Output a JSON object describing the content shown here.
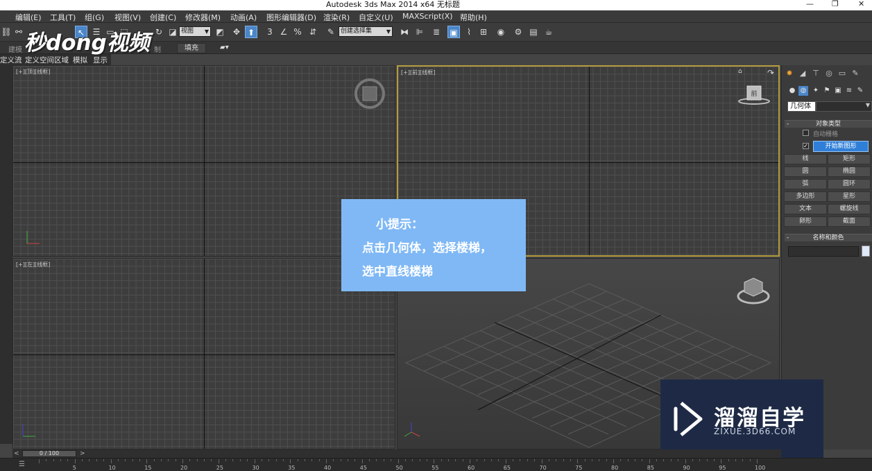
{
  "window": {
    "title": "Autodesk 3ds Max  2014 x64      无标题",
    "minimize": "—",
    "restore": "❐",
    "close": "✕"
  },
  "menu": [
    "编辑(E)",
    "工具(T)",
    "组(G)",
    "视图(V)",
    "创建(C)",
    "修改器(M)",
    "动画(A)",
    "图形编辑器(D)",
    "渲染(R)",
    "自定义(U)",
    "MAXScript(X)",
    "帮助(H)"
  ],
  "toolbar": {
    "refcoord_value": "视图",
    "named_selection_placeholder": "创建选择集",
    "snap_label": "3"
  },
  "ribbon": {
    "tabs": [
      "建模",
      "制",
      "填充"
    ],
    "fill_label": "填充"
  },
  "subribbon": {
    "items": [
      "定义流",
      "定义空间区域",
      "模拟",
      "显示"
    ]
  },
  "viewports": {
    "top": "[+][顶][线框]",
    "front": "[+][前][线框]",
    "left": "[+][左][线框]",
    "persp_cube": "前"
  },
  "command_panel": {
    "tooltip": "几何体",
    "rollout_object_type": "对象类型",
    "autogrid_label": "自动栅格",
    "start_new_shape": "开始新图形",
    "shapes": [
      "线",
      "矩形",
      "圆",
      "椭圆",
      "弧",
      "圆环",
      "多边形",
      "星形",
      "文本",
      "螺旋线",
      "卵形",
      "截面"
    ],
    "rollout_name_color": "名称和颜色",
    "accent_color": "#2f7fd8"
  },
  "tip": {
    "title": "小提示：",
    "lines": [
      "点击几何体，选择楼梯，",
      "选中直线楼梯"
    ]
  },
  "watermark": "秒dong视频",
  "logo": {
    "name": "溜溜自学",
    "url": "ZIXUE.3D66.COM"
  },
  "timeline": {
    "slider": "0 / 100",
    "prev": "<",
    "next": ">",
    "ticks": [
      "5",
      "10",
      "15",
      "20",
      "25",
      "30",
      "35",
      "40",
      "45",
      "50",
      "55",
      "60",
      "65",
      "70",
      "75",
      "80",
      "85",
      "90",
      "95",
      "100"
    ]
  }
}
